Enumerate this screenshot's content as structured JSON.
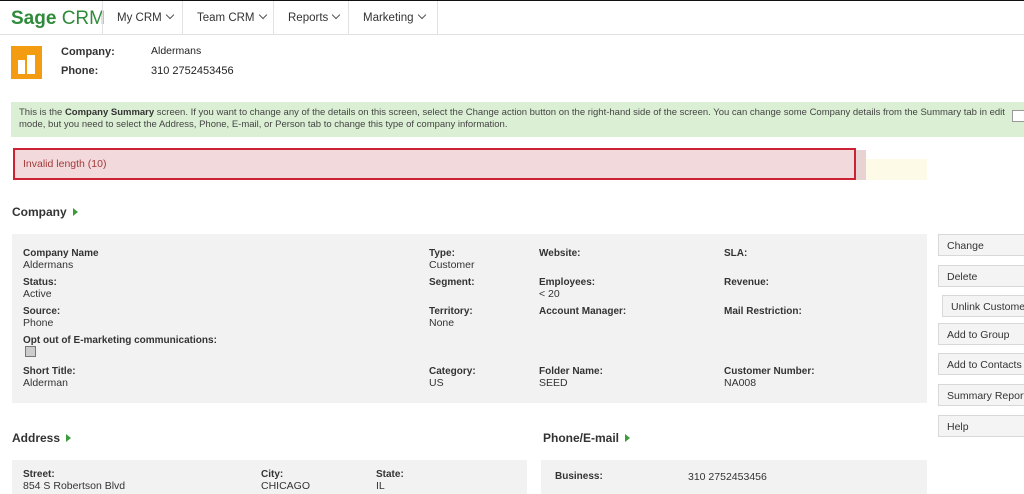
{
  "app": {
    "logo_bold": "Sage",
    "logo_rest": " CRM"
  },
  "nav": [
    {
      "label": "My CRM"
    },
    {
      "label": "Team CRM"
    },
    {
      "label": "Reports"
    },
    {
      "label": "Marketing"
    }
  ],
  "header": {
    "company_label": "Company:",
    "company_value": "Aldermans",
    "phone_label": "Phone:",
    "phone_value": "310 2752453456"
  },
  "info_banner": {
    "part1": "This is the ",
    "bold": "Company Summary",
    "part2": " screen. If you want to change any of the details on this screen, select the Change action button on the right-hand side of the screen. You can change some Company details from the Summary tab in edit mode, but you need to select the Address, Phone, E-mail, or Person tab to change this type of company information."
  },
  "error": {
    "message": "Invalid length (10)"
  },
  "company_section": {
    "title": "Company",
    "fields": {
      "company_name": {
        "label": "Company Name",
        "value": "Aldermans"
      },
      "type": {
        "label": "Type:",
        "value": "Customer"
      },
      "website": {
        "label": "Website:",
        "value": ""
      },
      "sla": {
        "label": "SLA:",
        "value": ""
      },
      "status": {
        "label": "Status:",
        "value": "Active"
      },
      "segment": {
        "label": "Segment:",
        "value": ""
      },
      "employees": {
        "label": "Employees:",
        "value": "< 20"
      },
      "revenue": {
        "label": "Revenue:",
        "value": ""
      },
      "source": {
        "label": "Source:",
        "value": "Phone"
      },
      "territory": {
        "label": "Territory:",
        "value": "None"
      },
      "account_manager": {
        "label": "Account Manager:",
        "value": ""
      },
      "mail_restriction": {
        "label": "Mail Restriction:",
        "value": ""
      },
      "opt_out": {
        "label": "Opt out of E-marketing communications:",
        "checked": false
      },
      "short_title": {
        "label": "Short Title:",
        "value": "Alderman"
      },
      "category": {
        "label": "Category:",
        "value": "US"
      },
      "folder_name": {
        "label": "Folder Name:",
        "value": "SEED"
      },
      "customer_number": {
        "label": "Customer Number:",
        "value": "NA008"
      }
    }
  },
  "address_section": {
    "title": "Address",
    "street": {
      "label": "Street:",
      "value": "854 S Robertson Blvd"
    },
    "city": {
      "label": "City:",
      "value": "CHICAGO"
    },
    "state": {
      "label": "State:",
      "value": "IL"
    }
  },
  "phone_section": {
    "title": "Phone/E-mail",
    "business": {
      "label": "Business:",
      "value": "310 2752453456"
    }
  },
  "actions": [
    {
      "label": "Change"
    },
    {
      "label": "Delete"
    },
    {
      "label": "Unlink Customer"
    },
    {
      "label": "Add to Group"
    },
    {
      "label": "Add to Contacts"
    },
    {
      "label": "Summary Report"
    },
    {
      "label": "Help"
    }
  ],
  "colors": {
    "brand_green": "#2e8b3a",
    "info_bg": "#dbefd4",
    "error_border": "#cc2233",
    "error_bg": "#f2d9db",
    "company_icon": "#f39c12"
  }
}
